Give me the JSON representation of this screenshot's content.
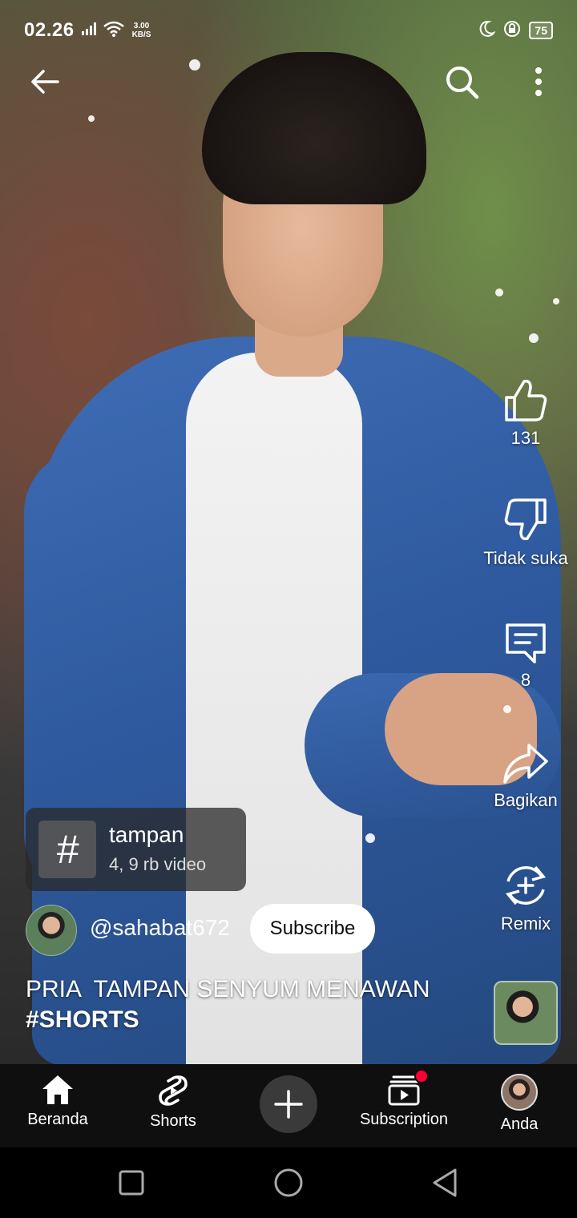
{
  "status_bar": {
    "time": "02.26",
    "net_speed_value": "3.00",
    "net_speed_unit": "KB/S",
    "battery": "75"
  },
  "actions": {
    "like_count": "131",
    "dislike_label": "Tidak suka",
    "comment_count": "8",
    "share_label": "Bagikan",
    "remix_label": "Remix"
  },
  "hashtag_chip": {
    "symbol": "#",
    "name": "tampan",
    "video_count": "4, 9 rb video"
  },
  "channel": {
    "handle": "@sahabat672",
    "subscribe_label": "Subscribe"
  },
  "video": {
    "title": "PRIA  TAMPAN SENYUM MENAWAN",
    "hashtag": "#SHORTS"
  },
  "bottom_nav": {
    "home_label": "Beranda",
    "shorts_label": "Shorts",
    "subscription_label": "Subscription",
    "you_label": "Anda"
  },
  "icons": {
    "back": "back-arrow-icon",
    "search": "search-icon",
    "more": "more-vertical-icon",
    "like": "thumbs-up-icon",
    "dislike": "thumbs-down-icon",
    "comment": "comment-icon",
    "share": "share-icon",
    "remix": "remix-icon",
    "home": "home-icon",
    "shorts": "shorts-icon",
    "create": "plus-icon",
    "subscriptions": "subscriptions-icon"
  },
  "colors": {
    "notification": "#ff0033",
    "nav_background": "#0f0f0f",
    "subscribe_button": "#ffffff"
  }
}
